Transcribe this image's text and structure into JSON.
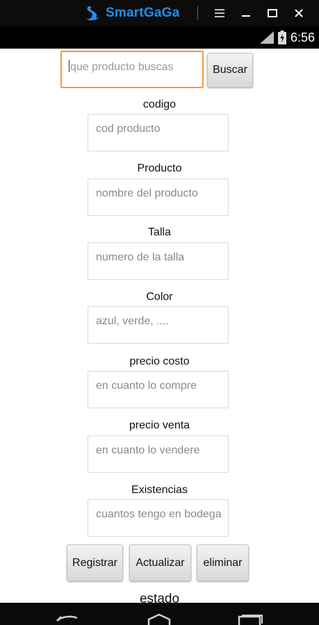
{
  "emulator": {
    "brand": "SmartGaGa",
    "icons": [
      "swan-logo-icon",
      "menu-icon",
      "minimize-icon",
      "maximize-icon",
      "close-icon"
    ]
  },
  "status_bar": {
    "time": "6:56",
    "icons": [
      "signal-icon",
      "battery-charging-icon"
    ]
  },
  "search": {
    "placeholder": "que producto buscas",
    "button_label": "Buscar"
  },
  "form": {
    "fields": [
      {
        "label": "codigo",
        "placeholder": "cod producto"
      },
      {
        "label": "Producto",
        "placeholder": "nombre del producto"
      },
      {
        "label": "Talla",
        "placeholder": "numero de la talla"
      },
      {
        "label": "Color",
        "placeholder": "azul, verde, ...."
      },
      {
        "label": "precio costo",
        "placeholder": "en cuanto lo compre"
      },
      {
        "label": "precio venta",
        "placeholder": "en cuanto lo vendere"
      },
      {
        "label": "Existencias",
        "placeholder": "cuantos tengo en bodega"
      }
    ]
  },
  "actions": {
    "registrar": "Registrar",
    "actualizar": "Actualizar",
    "eliminar": "eliminar"
  },
  "status_label": "estado",
  "colors": {
    "brand": "#1e8ff0",
    "focus_border": "#f39a2b",
    "title_bar": "#0c0c0c"
  }
}
